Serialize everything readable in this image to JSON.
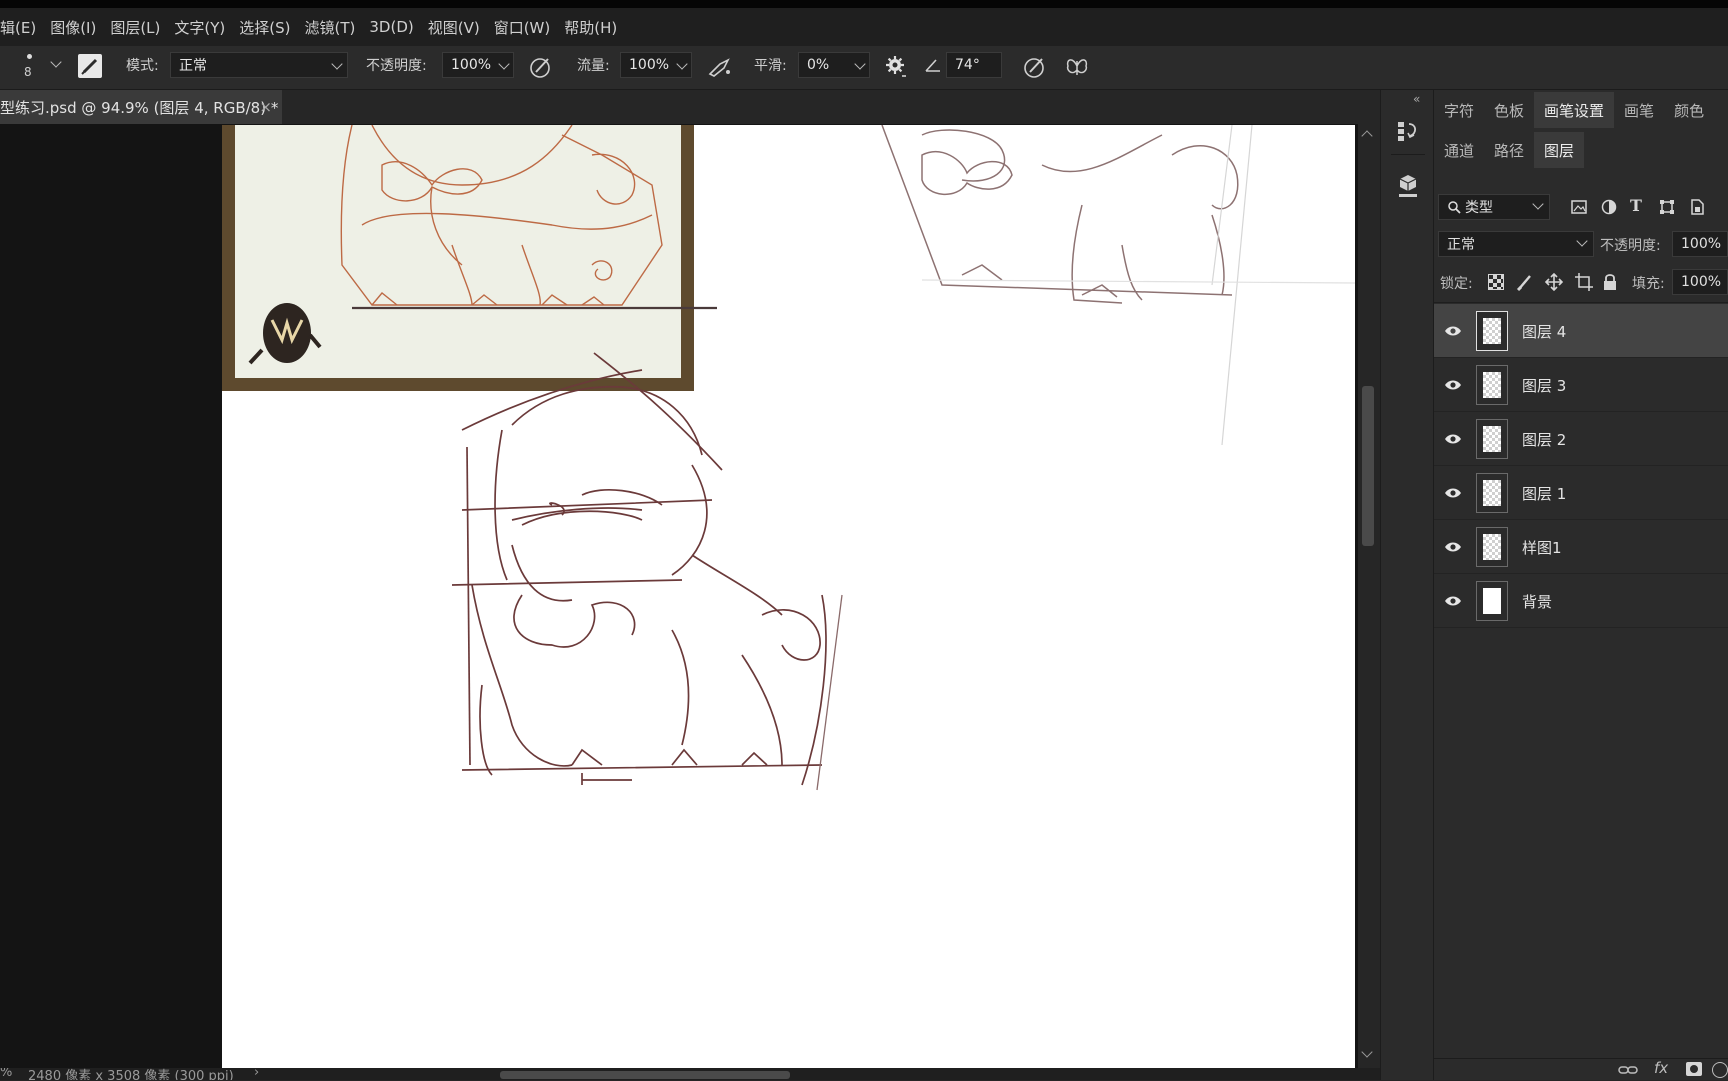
{
  "menu": [
    "辑(E)",
    "图像(I)",
    "图层(L)",
    "文字(Y)",
    "选择(S)",
    "滤镜(T)",
    "3D(D)",
    "视图(V)",
    "窗口(W)",
    "帮助(H)"
  ],
  "options": {
    "brush_size": "8",
    "mode_label": "模式:",
    "mode_value": "正常",
    "opacity_label": "不透明度:",
    "opacity_value": "100%",
    "flow_label": "流量:",
    "flow_value": "100%",
    "smooth_label": "平滑:",
    "smooth_value": "0%",
    "angle_value": "74°"
  },
  "document_tab": {
    "title": "型练习.psd @ 94.9% (图层 4, RGB/8) *",
    "close": "×"
  },
  "status": {
    "zoom": "%",
    "size": "2480 像素 x 3508 像素 (300 ppi)",
    "arrow": "›"
  },
  "panel": {
    "tabs_top": [
      "字符",
      "色板",
      "画笔设置",
      "画笔",
      "颜色"
    ],
    "tabs_top_active": "画笔设置",
    "tabs_second": [
      "通道",
      "路径",
      "图层"
    ],
    "tabs_second_active": "图层",
    "filter_kind": "类型",
    "blend_mode": "正常",
    "opacity_label": "不透明度:",
    "opacity_value": "100%",
    "lock_label": "锁定:",
    "fill_label": "填充:",
    "fill_value": "100%",
    "layers": [
      {
        "name": "图层 4",
        "selected": true,
        "thumb": "transparent"
      },
      {
        "name": "图层 3",
        "selected": false,
        "thumb": "transparent"
      },
      {
        "name": "图层 2",
        "selected": false,
        "thumb": "transparent"
      },
      {
        "name": "图层 1",
        "selected": false,
        "thumb": "transparent"
      },
      {
        "name": "样图1",
        "selected": false,
        "thumb": "transparent"
      },
      {
        "name": "背景",
        "selected": false,
        "thumb": "white"
      }
    ],
    "bottom_fx": "fx"
  },
  "colors": {
    "sketch_line": "#6b3a3a",
    "reference_line": "#b5532a",
    "reference_frame": "#5e4a2e",
    "reference_paper": "#eef0e6"
  }
}
